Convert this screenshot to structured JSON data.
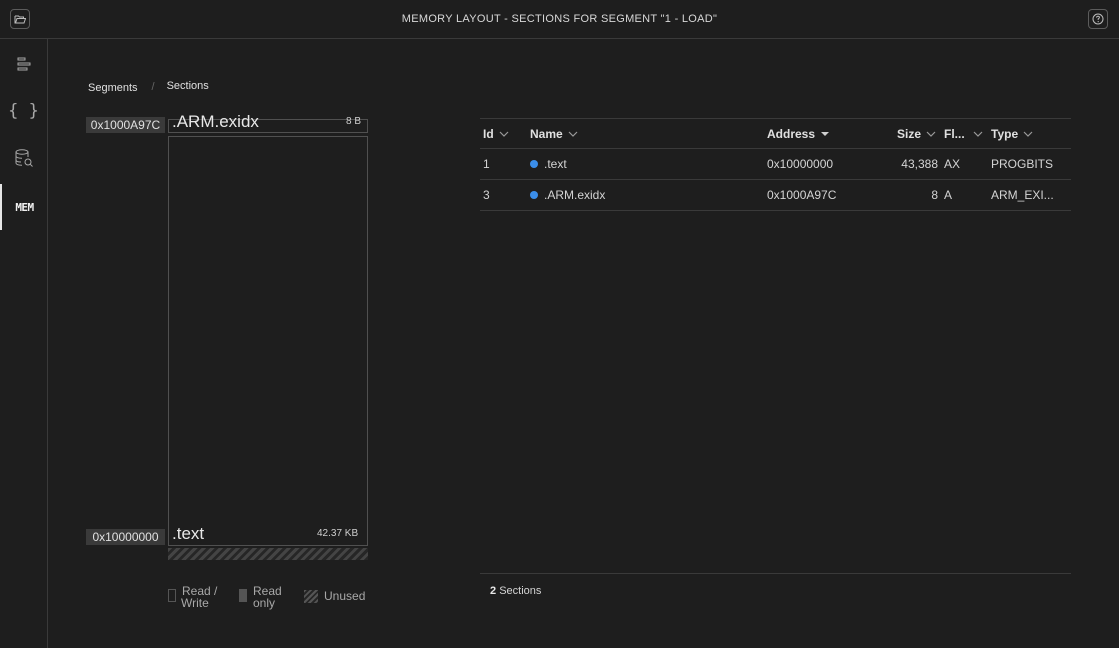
{
  "window": {
    "title": "MEMORY LAYOUT - SECTIONS FOR SEGMENT \"1 - LOAD\""
  },
  "titlebar": {
    "left_icon": "folder-open-icon",
    "right_icon": "help-icon"
  },
  "sidebar": {
    "items": [
      {
        "icon": "outline-icon",
        "label": ""
      },
      {
        "icon": "braces-icon",
        "label": "{ }"
      },
      {
        "icon": "database-search-icon",
        "label": ""
      },
      {
        "icon": "memory-icon",
        "label": "MEM",
        "active": true
      }
    ]
  },
  "breadcrumb": {
    "items": [
      "Segments",
      "Sections"
    ],
    "separator": "/"
  },
  "layout": {
    "top_address": "0x1000A97C",
    "bottom_address": "0x10000000",
    "sections": [
      {
        "name": ".ARM.exidx",
        "size": "8 B"
      },
      {
        "name": ".text",
        "size": "42.37 KB"
      }
    ],
    "legend": [
      {
        "label_line1": "Read /",
        "label_line2": "Write"
      },
      {
        "label_line1": "Read",
        "label_line2": "only"
      },
      {
        "label_line1": "Unused",
        "label_line2": ""
      }
    ]
  },
  "table": {
    "columns": [
      "Id",
      "Name",
      "Address",
      "Size",
      "Fl...",
      "Type"
    ],
    "rows": [
      {
        "id": "1",
        "name": ".text",
        "address": "0x10000000",
        "size": "43,388",
        "flags": "AX",
        "type": "PROGBITS"
      },
      {
        "id": "3",
        "name": ".ARM.exidx",
        "address": "0x1000A97C",
        "size": "8",
        "flags": "A",
        "type": "ARM_EXI..."
      }
    ]
  },
  "footer": {
    "count": "2",
    "label": "Sections"
  },
  "colors": {
    "accent_dot": "#3b8eea",
    "background": "#1e1e1e"
  }
}
